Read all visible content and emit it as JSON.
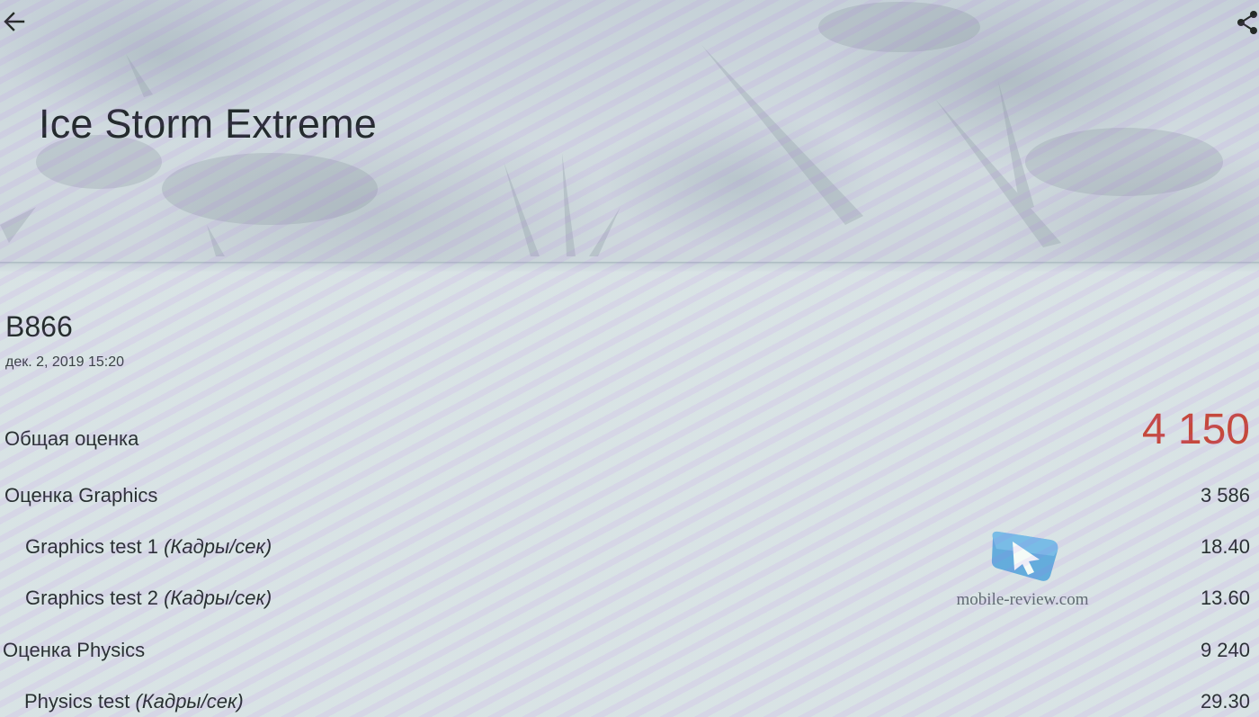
{
  "header": {
    "title": "Ice Storm Extreme",
    "back_icon": "arrow-left-icon",
    "share_icon": "share-icon"
  },
  "device": {
    "name": "B866",
    "date": "дек. 2, 2019 15:20"
  },
  "results": {
    "overall": {
      "label": "Общая оценка",
      "value": "4 150"
    },
    "graphics": {
      "label": "Оценка Graphics",
      "value": "3 586"
    },
    "graphics_test_1": {
      "label": "Graphics test 1",
      "unit": "(Кадры/сек)",
      "value": "18.40"
    },
    "graphics_test_2": {
      "label": "Graphics test 2",
      "unit": "(Кадры/сек)",
      "value": "13.60"
    },
    "physics": {
      "label": "Оценка Physics",
      "value": "9 240"
    },
    "physics_test": {
      "label": "Physics test",
      "unit": "(Кадры/сек)",
      "value": "29.30"
    }
  },
  "watermark": {
    "text": "mobile-review.com"
  },
  "colors": {
    "score_accent": "#c9352a",
    "text": "#15171c",
    "background": "#dfe4ea"
  }
}
